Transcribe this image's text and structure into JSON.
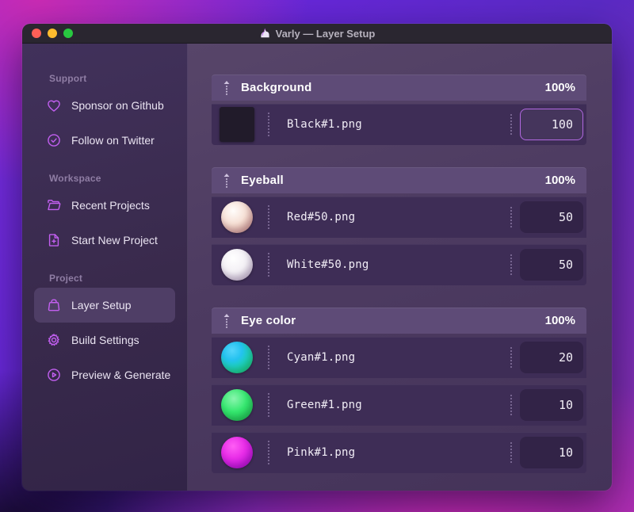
{
  "window": {
    "title": "Varly — Layer Setup",
    "app_icon": "unicorn-icon",
    "traffic_lights": [
      "close",
      "minimize",
      "zoom"
    ]
  },
  "sidebar": {
    "sections": [
      {
        "label": "Support",
        "items": [
          {
            "icon": "heart-icon",
            "label": "Sponsor on Github"
          },
          {
            "icon": "badge-check-icon",
            "label": "Follow on Twitter"
          }
        ]
      },
      {
        "label": "Workspace",
        "items": [
          {
            "icon": "folder-icon",
            "label": "Recent Projects"
          },
          {
            "icon": "file-plus-icon",
            "label": "Start New Project"
          }
        ]
      },
      {
        "label": "Project",
        "items": [
          {
            "icon": "archive-box-icon",
            "label": "Layer Setup",
            "active": true
          },
          {
            "icon": "gear-icon",
            "label": "Build Settings"
          },
          {
            "icon": "play-circle-icon",
            "label": "Preview & Generate"
          }
        ]
      }
    ]
  },
  "main": {
    "groups": [
      {
        "name": "Background",
        "weight": "100%",
        "layers": [
          {
            "thumb": "black-square",
            "file": "Black#1.png",
            "value": "100",
            "focused": true
          }
        ]
      },
      {
        "name": "Eyeball",
        "weight": "100%",
        "layers": [
          {
            "thumb": "red-sphere",
            "file": "Red#50.png",
            "value": "50"
          },
          {
            "thumb": "white-sphere",
            "file": "White#50.png",
            "value": "50"
          }
        ]
      },
      {
        "name": "Eye color",
        "weight": "100%",
        "layers": [
          {
            "thumb": "cyan-sphere",
            "file": "Cyan#1.png",
            "value": "20"
          },
          {
            "thumb": "green-sphere",
            "file": "Green#1.png",
            "value": "10"
          },
          {
            "thumb": "pink-sphere",
            "file": "Pink#1.png",
            "value": "10"
          }
        ]
      }
    ]
  },
  "colors": {
    "accent_icon": "#c25ff0",
    "focused_input_border": "#b168e0",
    "group_header_bg": "#5e4b77",
    "row_bg": "#3e2d56",
    "sidebar_bg": "#392a4c",
    "titlebar_bg": "#2a2630",
    "traffic_red": "#ff5f57",
    "traffic_yellow": "#febc2e",
    "traffic_green": "#28c840"
  }
}
